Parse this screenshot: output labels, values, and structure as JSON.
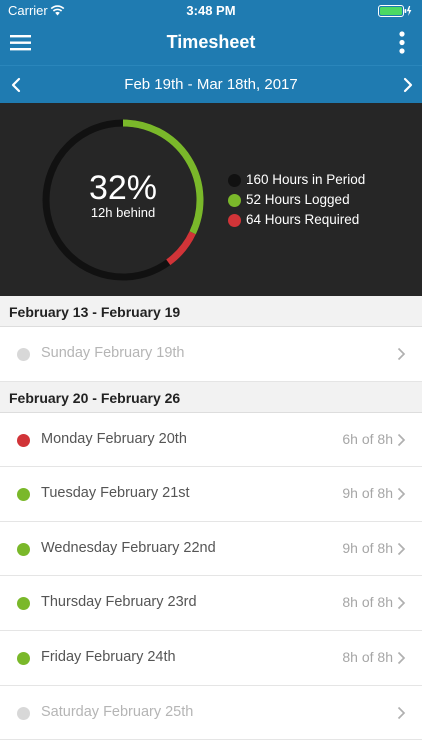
{
  "status_bar": {
    "carrier": "Carrier",
    "time": "3:48 PM"
  },
  "nav": {
    "title": "Timesheet",
    "menu_icon": "hamburger-menu-icon",
    "more_icon": "vertical-ellipsis-icon"
  },
  "period": {
    "label": "Feb 19th - Mar 18th, 2017"
  },
  "summary": {
    "percent_text": "32%",
    "behind_text": "12h behind",
    "progress": {
      "logged_fraction": 0.32,
      "required_fraction": 0.4
    },
    "legend": [
      {
        "label": "160 Hours in Period",
        "color": "#111111"
      },
      {
        "label": "52 Hours Logged",
        "color": "#7ab82a"
      },
      {
        "label": "64 Hours Required",
        "color": "#d13438"
      }
    ]
  },
  "colors": {
    "header_blue": "#1f7bb1",
    "summary_bg": "#262626",
    "green": "#7ab82a",
    "red": "#d13438",
    "grey_dot": "#d8d8d8"
  },
  "weeks": [
    {
      "title": "February 13 - February 19",
      "days": [
        {
          "label": "Sunday February 19th",
          "hours": "",
          "status": "none",
          "disabled": true
        }
      ]
    },
    {
      "title": "February 20 - February 26",
      "days": [
        {
          "label": "Monday February 20th",
          "hours": "6h of 8h",
          "status": "red",
          "disabled": false
        },
        {
          "label": "Tuesday February 21st",
          "hours": "9h of 8h",
          "status": "green",
          "disabled": false
        },
        {
          "label": "Wednesday February 22nd",
          "hours": "9h of 8h",
          "status": "green",
          "disabled": false
        },
        {
          "label": "Thursday February 23rd",
          "hours": "8h of 8h",
          "status": "green",
          "disabled": false
        },
        {
          "label": "Friday February 24th",
          "hours": "8h of 8h",
          "status": "green",
          "disabled": false
        },
        {
          "label": "Saturday February 25th",
          "hours": "",
          "status": "none",
          "disabled": true
        }
      ]
    }
  ]
}
